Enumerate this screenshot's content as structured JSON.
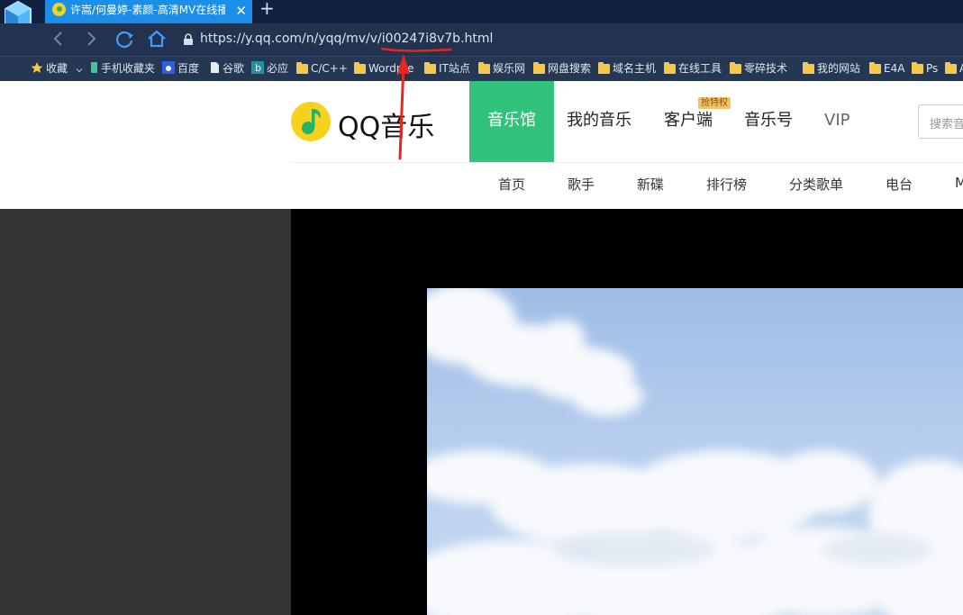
{
  "browser": {
    "tab": {
      "title": "许嵩/何曼婷-素颜-高清MV在线播放"
    },
    "url": "https://y.qq.com/n/yqq/mv/v/i00247i8v7b.html",
    "bookmarks": [
      {
        "label": "收藏",
        "icon": "star-icon"
      },
      {
        "label": "手机收藏夹",
        "icon": "phone-icon"
      },
      {
        "label": "百度",
        "icon": "baidu-icon"
      },
      {
        "label": "谷歌",
        "icon": "page-icon"
      },
      {
        "label": "必应",
        "icon": "bing-icon"
      },
      {
        "label": "C/C++",
        "icon": "folder-icon"
      },
      {
        "label": "Wordpre",
        "icon": "folder-icon"
      },
      {
        "label": "IT站点",
        "icon": "folder-icon"
      },
      {
        "label": "娱乐网",
        "icon": "folder-icon"
      },
      {
        "label": "网盘搜索",
        "icon": "folder-icon"
      },
      {
        "label": "域名主机",
        "icon": "folder-icon"
      },
      {
        "label": "在线工具",
        "icon": "folder-icon"
      },
      {
        "label": "零碎技术",
        "icon": "folder-icon"
      },
      {
        "label": "我的网站",
        "icon": "folder-icon"
      },
      {
        "label": "E4A",
        "icon": "folder-icon"
      },
      {
        "label": "Ps",
        "icon": "folder-icon"
      },
      {
        "label": "A",
        "icon": "folder-icon"
      }
    ]
  },
  "site": {
    "logo_text": "QQ音乐",
    "main_nav": [
      "音乐馆",
      "我的音乐",
      "客户端",
      "音乐号",
      "VIP"
    ],
    "badge": "抢特权",
    "search_placeholder": "搜索音乐",
    "sub_nav": [
      "首页",
      "歌手",
      "新碟",
      "排行榜",
      "分类歌单",
      "电台",
      "M"
    ]
  },
  "colors": {
    "accent": "#31c27c",
    "annotation": "#e8261e",
    "tab_active": "#1a8ee8"
  }
}
